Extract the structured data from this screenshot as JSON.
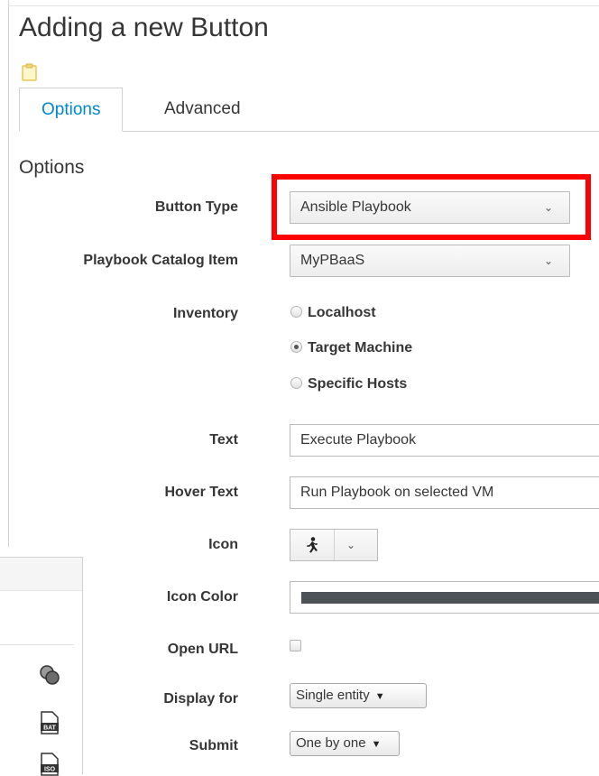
{
  "page": {
    "title": "Adding a new Button"
  },
  "tabs": [
    {
      "label": "Options",
      "active": true
    },
    {
      "label": "Advanced",
      "active": false
    }
  ],
  "section_title": "Options",
  "form": {
    "button_type": {
      "label": "Button Type",
      "value": "Ansible Playbook"
    },
    "playbook_catalog_item": {
      "label": "Playbook Catalog Item",
      "value": "MyPBaaS"
    },
    "inventory": {
      "label": "Inventory",
      "options": [
        {
          "label": "Localhost",
          "selected": false
        },
        {
          "label": "Target Machine",
          "selected": true
        },
        {
          "label": "Specific Hosts",
          "selected": false
        }
      ]
    },
    "text": {
      "label": "Text",
      "value": "Execute Playbook"
    },
    "hover_text": {
      "label": "Hover Text",
      "value": "Run Playbook on selected VM"
    },
    "icon": {
      "label": "Icon",
      "selected_icon": "running-person-icon"
    },
    "icon_color": {
      "label": "Icon Color",
      "value": "#4d5258"
    },
    "open_url": {
      "label": "Open URL",
      "checked": false
    },
    "display_for": {
      "label": "Display for",
      "value": "Single entity"
    },
    "submit": {
      "label": "Submit",
      "value": "One by one"
    }
  },
  "colors": {
    "accent": "#0088ce",
    "highlight": "#ff0000",
    "text": "#363636"
  },
  "background_panel": {
    "icons": [
      "overlapping-circles-icon",
      "bat-file-icon",
      "iso-file-icon"
    ],
    "icon_labels": [
      "BAT",
      "ISO"
    ]
  }
}
